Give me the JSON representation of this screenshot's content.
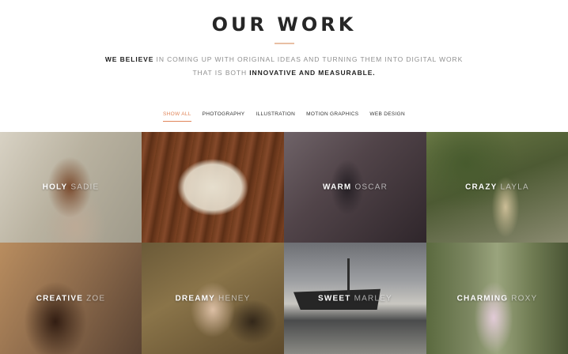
{
  "header": {
    "title": "OUR WORK",
    "intro_lead": "WE BELIEVE",
    "intro_text": " IN COMING UP WITH ORIGINAL IDEAS AND TURNING THEM INTO DIGITAL WORK THAT IS BOTH ",
    "intro_emphasis": "INNOVATIVE AND MEASURABLE."
  },
  "filters": [
    {
      "label": "SHOW ALL",
      "active": true
    },
    {
      "label": "PHOTOGRAPHY",
      "active": false
    },
    {
      "label": "ILLUSTRATION",
      "active": false
    },
    {
      "label": "MOTION GRAPHICS",
      "active": false
    },
    {
      "label": "WEB DESIGN",
      "active": false
    }
  ],
  "portfolio": [
    {
      "title": "HOLY",
      "name": "SADIE"
    },
    {
      "title": "",
      "name": ""
    },
    {
      "title": "WARM",
      "name": "OSCAR"
    },
    {
      "title": "CRAZY",
      "name": "LAYLA"
    },
    {
      "title": "CREATIVE",
      "name": "ZOE"
    },
    {
      "title": "DREAMY",
      "name": "HENEY"
    },
    {
      "title": "SWEET",
      "name": "MARLEY"
    },
    {
      "title": "CHARMING",
      "name": "ROXY"
    }
  ]
}
